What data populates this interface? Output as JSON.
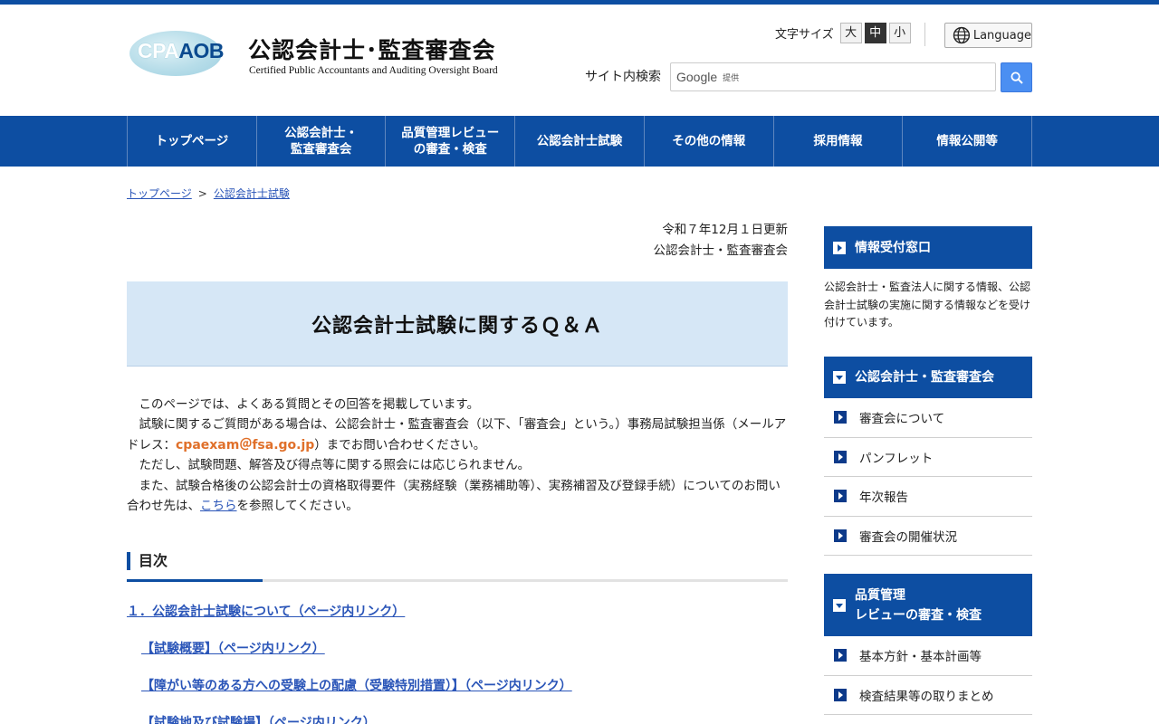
{
  "header": {
    "logo_mark_a": "CPA",
    "logo_mark_b": "AOB",
    "org_name": "公認会計士･監査審査会",
    "org_name_en": "Certified Public Accountants and Auditing Oversight Board",
    "fontsize_label": "文字サイズ",
    "fontsize_options": [
      "大",
      "中",
      "小"
    ],
    "fontsize_selected": "中",
    "language_label": "Language",
    "search_label": "サイト内検索",
    "search_brand": "Google",
    "search_provided": "提供"
  },
  "gnav": {
    "items": [
      {
        "label": "トップページ"
      },
      {
        "label": "公認会計士・\n監査審査会"
      },
      {
        "label": "品質管理レビュー\nの審査・検査"
      },
      {
        "label": "公認会計士試験"
      },
      {
        "label": "その他の情報"
      },
      {
        "label": "採用情報"
      },
      {
        "label": "情報公開等"
      }
    ]
  },
  "breadcrumb": {
    "items": [
      "トップページ",
      "公認会計士試験"
    ],
    "separator": ">"
  },
  "main": {
    "updated": "令和７年12月１日更新",
    "author": "公認会計士・監査審査会",
    "title": "公認会計士試験に関するＱ＆Ａ",
    "intro": {
      "p1": "このページでは、よくある質問とその回答を掲載しています。",
      "p2a": "試験に関するご質問がある場合は、公認会計士・監査審査会（以下、「審査会」という。）事務局試験担当係（メールアドレス：",
      "mail": "cpaexam＠fsa.go.jp",
      "p2b": "）までお問い合わせください。",
      "p3": "ただし、試験問題、解答及び得点等に関する照会には応じられません。",
      "p4a": "また、試験合格後の公認会計士の資格取得要件（実務経験（業務補助等）、実務補習及び登録手続）についてのお問い合わせ先は、",
      "p4link": "こちら",
      "p4b": "を参照してください。"
    },
    "toc_heading": "目次",
    "toc": [
      {
        "label": "１．公認会計士試験について（ページ内リンク）"
      },
      {
        "label": "【試験概要】（ページ内リンク）"
      },
      {
        "label": "【障がい等のある方への受験上の配慮（受験特別措置）】（ページ内リンク）"
      },
      {
        "label": "【試験地及び試験場】（ページ内リンク）"
      }
    ]
  },
  "sidebar": {
    "info_head": "情報受付窓口",
    "info_text": "公認会計士・監査法人に関する情報、公認会計士試験の実施に関する情報などを受け付けています。",
    "board_head": "公認会計士・監査審査会",
    "board_items": [
      "審査会について",
      "パンフレット",
      "年次報告",
      "審査会の開催状況"
    ],
    "review_head_1": "品質管理",
    "review_head_2": "レビューの審査・検査",
    "review_items": [
      "基本方針・基本計画等",
      "検査結果等の取りまとめ"
    ]
  }
}
